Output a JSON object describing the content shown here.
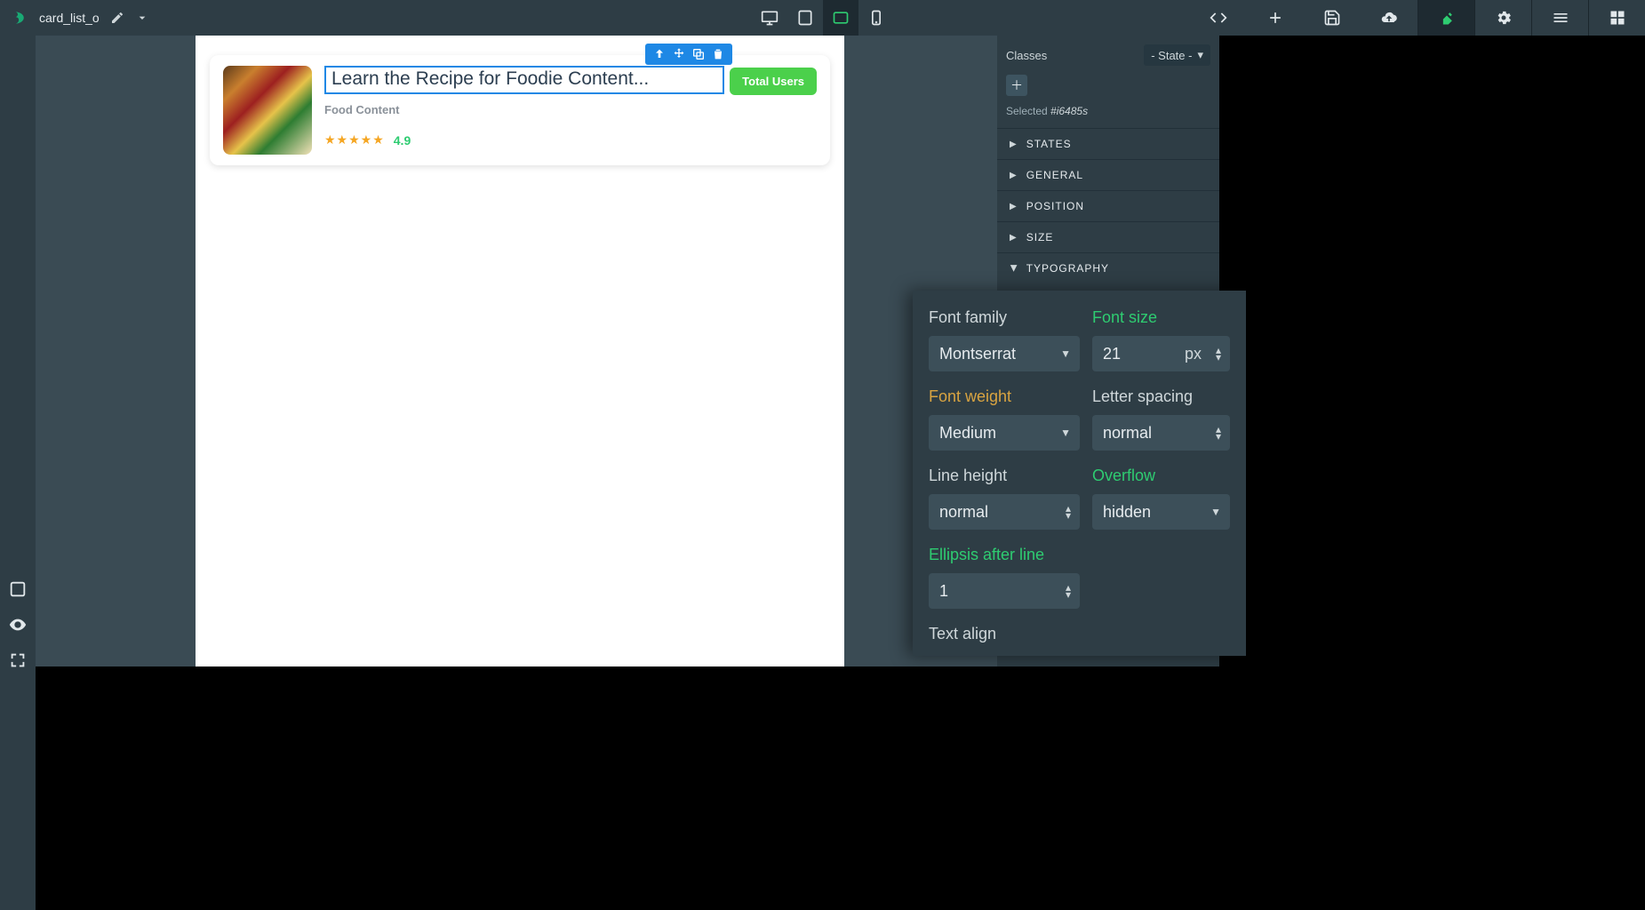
{
  "header": {
    "file_name": "card_list_o"
  },
  "card": {
    "title": "Learn the Recipe for Foodie Content...",
    "subtitle": "Food Content",
    "badge": "Total Users",
    "rating": "4.9"
  },
  "right_panel": {
    "classes_label": "Classes",
    "state_label": "- State -",
    "selected_prefix": "Selected",
    "selected_id": "#i6485s",
    "sections": {
      "states": "STATES",
      "general": "GENERAL",
      "position": "POSITION",
      "size": "SIZE",
      "typography": "TYPOGRAPHY"
    }
  },
  "typography": {
    "font_family_label": "Font family",
    "font_family_value": "Montserrat",
    "font_size_label": "Font size",
    "font_size_value": "21",
    "font_size_unit": "px",
    "font_weight_label": "Font weight",
    "font_weight_value": "Medium",
    "letter_spacing_label": "Letter spacing",
    "letter_spacing_value": "normal",
    "line_height_label": "Line height",
    "line_height_value": "normal",
    "overflow_label": "Overflow",
    "overflow_value": "hidden",
    "ellipsis_label": "Ellipsis after line",
    "ellipsis_value": "1",
    "text_align_label": "Text align"
  }
}
